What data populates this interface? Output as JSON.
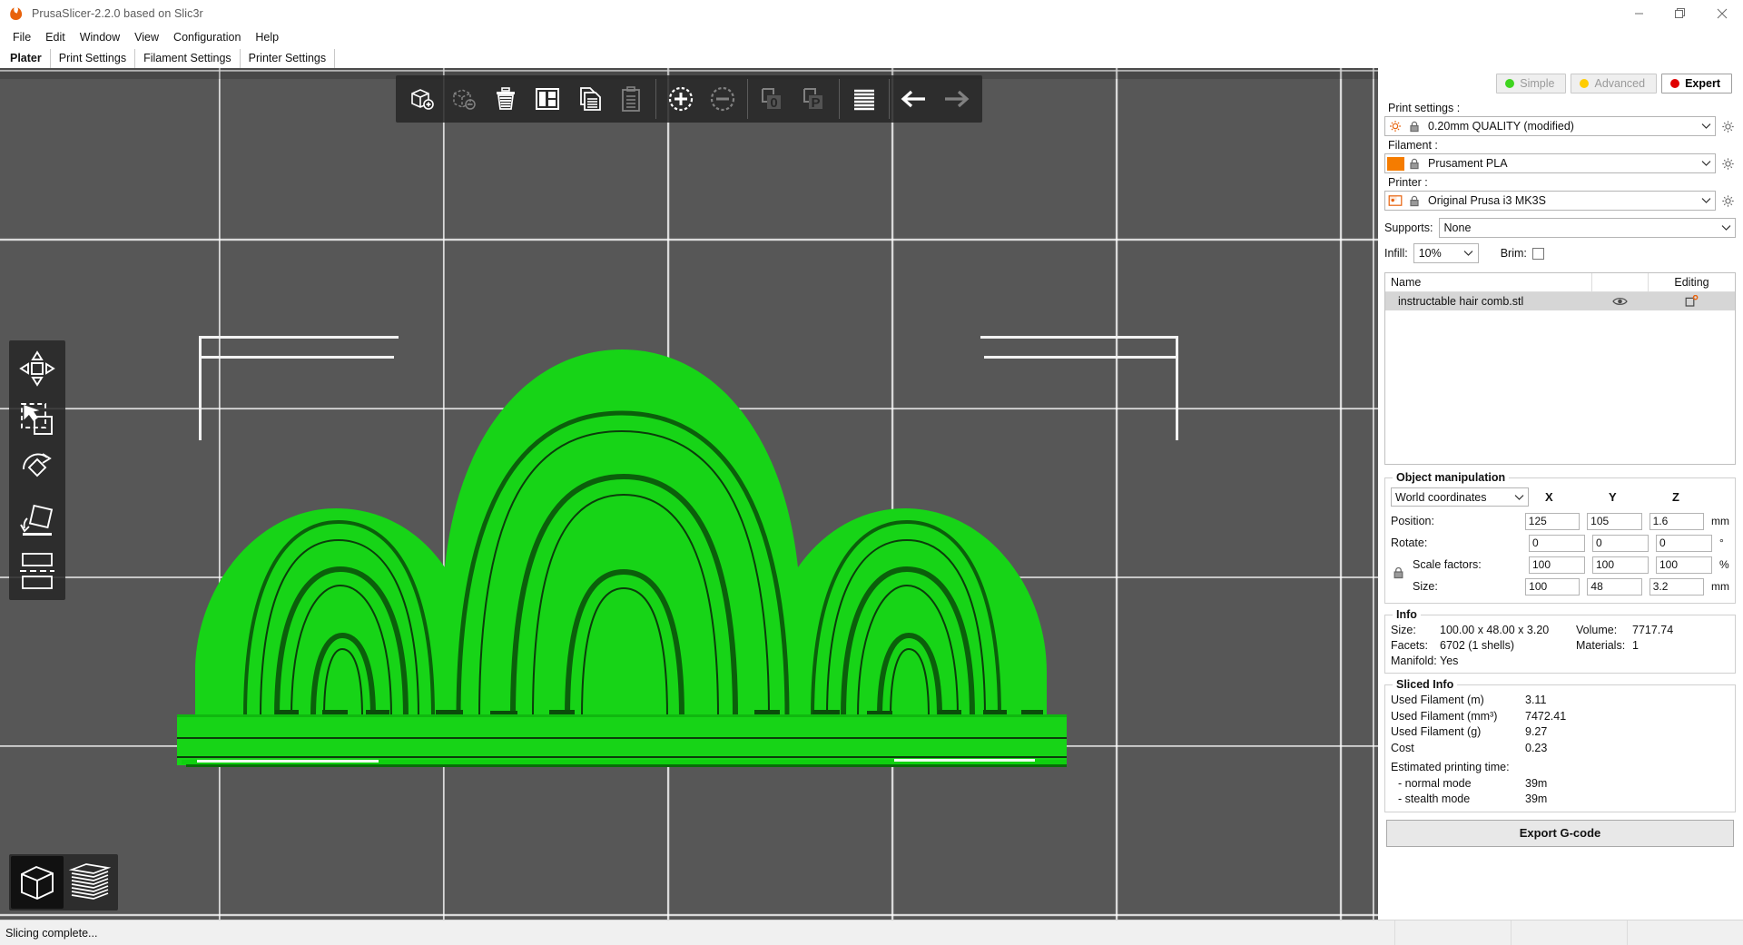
{
  "window": {
    "title": "PrusaSlicer-2.2.0 based on Slic3r",
    "app_icon": "prusa-logo-icon",
    "minimize": "minimize-icon",
    "maximize": "maximize-icon",
    "close": "close-icon"
  },
  "menu": [
    "File",
    "Edit",
    "Window",
    "View",
    "Configuration",
    "Help"
  ],
  "tabs": [
    {
      "label": "Plater",
      "active": true
    },
    {
      "label": "Print Settings",
      "active": false
    },
    {
      "label": "Filament Settings",
      "active": false
    },
    {
      "label": "Printer Settings",
      "active": false
    }
  ],
  "toolbar": {
    "items": [
      {
        "name": "add-object",
        "tip": "Add",
        "disabled": false
      },
      {
        "name": "delete-object",
        "tip": "Delete",
        "disabled": true
      },
      {
        "name": "delete-all",
        "tip": "Delete all",
        "disabled": false
      },
      {
        "name": "arrange",
        "tip": "Arrange",
        "disabled": false
      },
      {
        "name": "copy",
        "tip": "Copy",
        "disabled": false
      },
      {
        "name": "paste",
        "tip": "Paste",
        "disabled": true
      },
      {
        "name": "add-instance",
        "tip": "Add instance",
        "disabled": false
      },
      {
        "name": "remove-instance",
        "tip": "Remove instance",
        "disabled": true
      },
      {
        "name": "split-to-objects",
        "tip": "Split to objects",
        "disabled": true
      },
      {
        "name": "split-to-parts",
        "tip": "Split to parts",
        "disabled": true
      },
      {
        "name": "layers-editing",
        "tip": "Variable layer height",
        "disabled": false
      },
      {
        "name": "undo",
        "tip": "Undo",
        "disabled": false
      },
      {
        "name": "redo",
        "tip": "Redo",
        "disabled": true
      }
    ],
    "split_labels": {
      "objects": "0",
      "parts": "P"
    }
  },
  "gizmos": [
    {
      "name": "move-gizmo"
    },
    {
      "name": "scale-gizmo"
    },
    {
      "name": "rotate-gizmo"
    },
    {
      "name": "place-on-face-gizmo"
    },
    {
      "name": "cut-gizmo"
    }
  ],
  "view_switch": [
    {
      "name": "editor-view",
      "active": true
    },
    {
      "name": "preview-view",
      "active": false
    }
  ],
  "sidebar": {
    "modes": [
      {
        "label": "Simple",
        "color": "#3fd41f",
        "active": false
      },
      {
        "label": "Advanced",
        "color": "#ffcc00",
        "active": false
      },
      {
        "label": "Expert",
        "color": "#e00000",
        "active": true
      }
    ],
    "presets": [
      {
        "label": "Print settings :",
        "value": "0.20mm QUALITY (modified)",
        "icon": "cog-icon",
        "lock": "lock-closed-icon",
        "gear": "gear-icon"
      },
      {
        "label": "Filament :",
        "value": "Prusament PLA",
        "icon": "filament-swatch-icon",
        "swatch": "#f57c00",
        "lock": "lock-closed-icon",
        "gear": "gear-icon"
      },
      {
        "label": "Printer :",
        "value": "Original Prusa i3 MK3S",
        "icon": "printer-icon",
        "lock": "lock-closed-icon",
        "gear": "gear-icon"
      }
    ],
    "supports": {
      "label": "Supports:",
      "value": "None"
    },
    "infill": {
      "label": "Infill:",
      "value": "10%"
    },
    "brim": {
      "label": "Brim:",
      "checked": false
    },
    "object_list": {
      "columns": [
        "Name",
        "",
        "Editing"
      ],
      "rows": [
        {
          "name": "instructable hair comb.stl",
          "eye": "eye-icon",
          "editing": "editing-icon"
        }
      ]
    },
    "object_manipulation": {
      "title": "Object manipulation",
      "coord_system": "World coordinates",
      "axes": [
        "X",
        "Y",
        "Z"
      ],
      "rows": [
        {
          "label": "Position:",
          "values": [
            "125",
            "105",
            "1.6"
          ],
          "unit": "mm",
          "indent": false
        },
        {
          "label": "Rotate:",
          "values": [
            "0",
            "0",
            "0"
          ],
          "unit": "°",
          "indent": false
        },
        {
          "label": "Scale factors:",
          "values": [
            "100",
            "100",
            "100"
          ],
          "unit": "%",
          "indent": true
        },
        {
          "label": "Size:",
          "values": [
            "100",
            "48",
            "3.2"
          ],
          "unit": "mm",
          "indent": true
        }
      ],
      "uniform_lock": "lock-closed-icon"
    },
    "info": {
      "title": "Info",
      "size_label": "Size:",
      "size_value": "100.00 x 48.00 x 3.20",
      "volume_label": "Volume:",
      "volume_value": "7717.74",
      "facets_label": "Facets:",
      "facets_value": "6702 (1 shells)",
      "materials_label": "Materials:",
      "materials_value": "1",
      "manifold_label": "Manifold:",
      "manifold_value": "Yes"
    },
    "sliced_info": {
      "title": "Sliced Info",
      "rows": [
        {
          "label": "Used Filament (m)",
          "value": "3.11"
        },
        {
          "label": "Used Filament (mm³)",
          "value": "7472.41"
        },
        {
          "label": "Used Filament (g)",
          "value": "9.27"
        },
        {
          "label": "Cost",
          "value": "0.23"
        }
      ],
      "time_title": "Estimated printing time:",
      "times": [
        {
          "label": "- normal mode",
          "value": "39m"
        },
        {
          "label": "- stealth mode",
          "value": "39m"
        }
      ]
    },
    "export_button": "Export G-code"
  },
  "statusbar": {
    "message": "Slicing complete..."
  },
  "viewport": {
    "model_name": "instructable hair comb.stl",
    "model_color": "#21db21",
    "bed_color": "#575757",
    "grid_color": "#f2f2f2"
  }
}
